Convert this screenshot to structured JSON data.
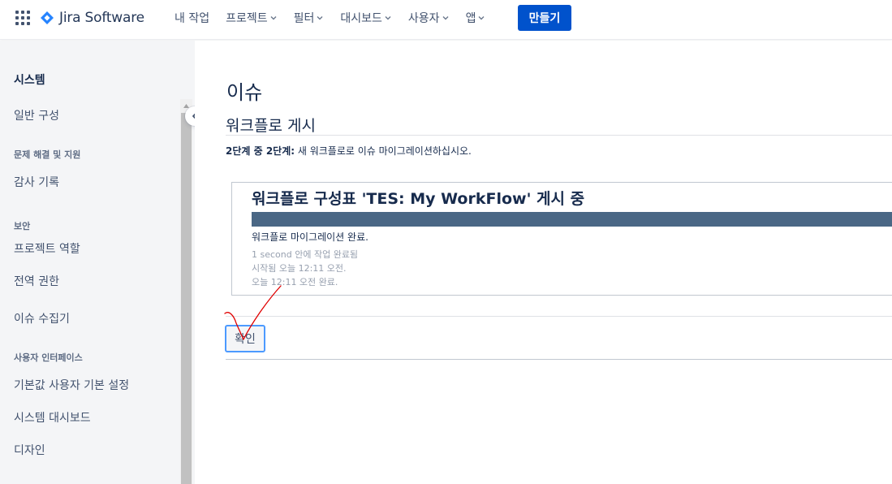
{
  "header": {
    "app_name": "Jira Software",
    "nav": [
      {
        "label": "내 작업",
        "has_menu": false
      },
      {
        "label": "프로젝트",
        "has_menu": true
      },
      {
        "label": "필터",
        "has_menu": true
      },
      {
        "label": "대시보드",
        "has_menu": true
      },
      {
        "label": "사용자",
        "has_menu": true
      },
      {
        "label": "앱",
        "has_menu": true
      }
    ],
    "create_label": "만들기",
    "brand_color": "#0052cc"
  },
  "sidebar": {
    "title": "시스템",
    "items": [
      {
        "type": "item",
        "label": "일반 구성"
      },
      {
        "type": "heading",
        "label": "문제 해결 및 지원"
      },
      {
        "type": "item",
        "label": "감사 기록"
      },
      {
        "type": "heading",
        "label": "보안"
      },
      {
        "type": "item",
        "label": "프로젝트 역할"
      },
      {
        "type": "item",
        "label": "전역 권한"
      },
      {
        "type": "item",
        "label": "이슈 수집기"
      },
      {
        "type": "heading",
        "label": "사용자 인터페이스"
      },
      {
        "type": "item",
        "label": "기본값 사용자 기본 설정"
      },
      {
        "type": "item",
        "label": "시스템 대시보드"
      },
      {
        "type": "item",
        "label": "디자인"
      }
    ]
  },
  "main": {
    "page_title": "이슈",
    "section_title": "워크플로 게시",
    "step_bold": "2단계 중 2단계:",
    "step_text": " 새 워크플로로 이슈 마이그레이션하십시오.",
    "progress": {
      "title": "워크플로 구성표 'TES: My WorkFlow' 게시 중",
      "percent": 100,
      "bar_color": "#4a6785",
      "status": "워크플로 마이그레이션 완료.",
      "duration": "1 second 안에 작업 완료됨",
      "started": "시작됨 오늘 12:11 오전.",
      "finished": "오늘 12:11 오전 완료."
    },
    "ok_label": "확인"
  },
  "annotation_color": "#e00000"
}
